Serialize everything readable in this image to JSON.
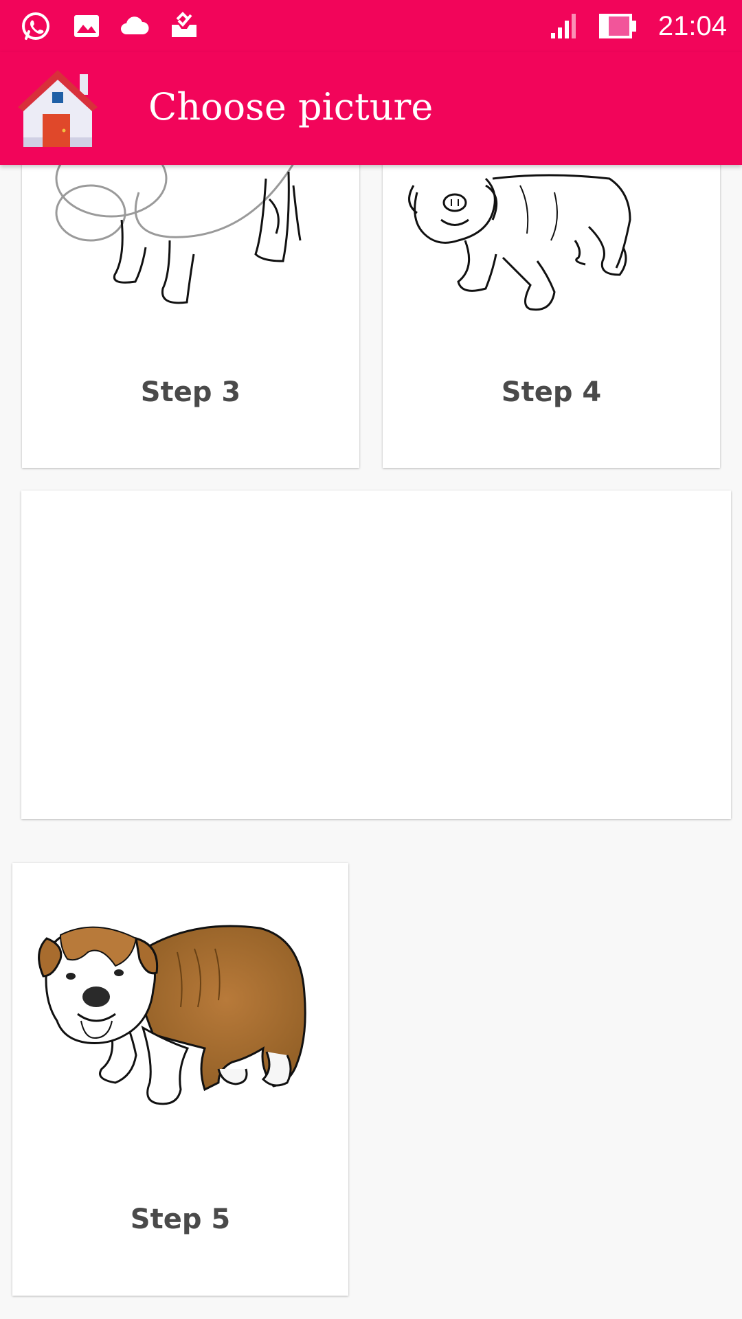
{
  "status_bar": {
    "time": "21:04",
    "icons": [
      "whatsapp-icon",
      "gallery-icon",
      "cloud-icon",
      "inbox-check-icon",
      "signal-icon",
      "battery-icon"
    ]
  },
  "app_bar": {
    "title": "Choose picture",
    "home_icon": "house-icon",
    "background": "#f2055a"
  },
  "cards": [
    {
      "label": "Step 3",
      "image": "bulldog-outline-step-3"
    },
    {
      "label": "Step 4",
      "image": "bulldog-outline-step-4"
    },
    {
      "label": "",
      "image": "blank-ad-card"
    },
    {
      "label": "Step 5",
      "image": "bulldog-colored-step-5"
    }
  ]
}
